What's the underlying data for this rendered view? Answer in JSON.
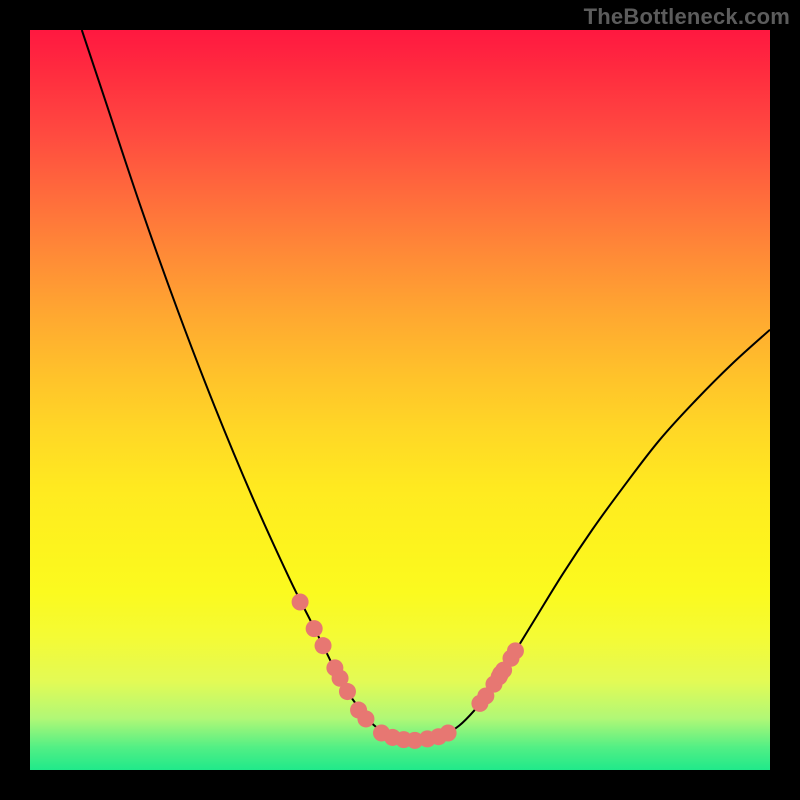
{
  "watermark": "TheBottleneck.com",
  "colors": {
    "frame_border": "#000000",
    "curve_stroke": "#000000",
    "marker_fill": "#e77772",
    "marker_stroke": "#e77772",
    "gradient_top": "#ff1840",
    "gradient_bottom": "#20e98a"
  },
  "chart_data": {
    "type": "line",
    "title": "",
    "xlabel": "",
    "ylabel": "",
    "xlim": [
      0,
      100
    ],
    "ylim": [
      0,
      100
    ],
    "grid": false,
    "legend": false,
    "series": [
      {
        "name": "curve-left",
        "x": [
          7,
          10,
          15,
          20,
          25,
          30,
          35,
          38,
          40,
          42,
          44,
          46,
          48,
          50,
          52
        ],
        "y_from_top": [
          0,
          9,
          24,
          38,
          51,
          63,
          74,
          80,
          84,
          88,
          91,
          93.5,
          95,
          95.8,
          96
        ]
      },
      {
        "name": "curve-right",
        "x": [
          52,
          54,
          56,
          58,
          60,
          62,
          64,
          68,
          72,
          76,
          80,
          85,
          90,
          95,
          100
        ],
        "y_from_top": [
          96,
          95.8,
          95.2,
          94,
          92,
          89.5,
          86.5,
          80,
          73.5,
          67.5,
          62,
          55.5,
          50,
          45,
          40.5
        ]
      }
    ],
    "markers": [
      {
        "x": 36.5,
        "y_from_top": 77.3
      },
      {
        "x": 38.4,
        "y_from_top": 80.9
      },
      {
        "x": 39.6,
        "y_from_top": 83.2
      },
      {
        "x": 41.2,
        "y_from_top": 86.2
      },
      {
        "x": 41.9,
        "y_from_top": 87.6
      },
      {
        "x": 42.9,
        "y_from_top": 89.4
      },
      {
        "x": 44.4,
        "y_from_top": 91.9
      },
      {
        "x": 45.4,
        "y_from_top": 93.1
      },
      {
        "x": 47.5,
        "y_from_top": 95.0
      },
      {
        "x": 49.0,
        "y_from_top": 95.6
      },
      {
        "x": 50.5,
        "y_from_top": 95.9
      },
      {
        "x": 52.0,
        "y_from_top": 96.0
      },
      {
        "x": 53.7,
        "y_from_top": 95.8
      },
      {
        "x": 55.2,
        "y_from_top": 95.5
      },
      {
        "x": 56.5,
        "y_from_top": 95.0
      },
      {
        "x": 60.8,
        "y_from_top": 91.0
      },
      {
        "x": 61.6,
        "y_from_top": 90.0
      },
      {
        "x": 62.7,
        "y_from_top": 88.4
      },
      {
        "x": 63.4,
        "y_from_top": 87.4
      },
      {
        "x": 63.6,
        "y_from_top": 87.0
      },
      {
        "x": 64.0,
        "y_from_top": 86.5
      },
      {
        "x": 65.0,
        "y_from_top": 84.9
      },
      {
        "x": 65.6,
        "y_from_top": 83.9
      }
    ],
    "note": "y_from_top = 0 is top edge (red), 100 is bottom edge (green). Curve is an asymmetric V reaching minimum bottleneck near x≈52."
  }
}
